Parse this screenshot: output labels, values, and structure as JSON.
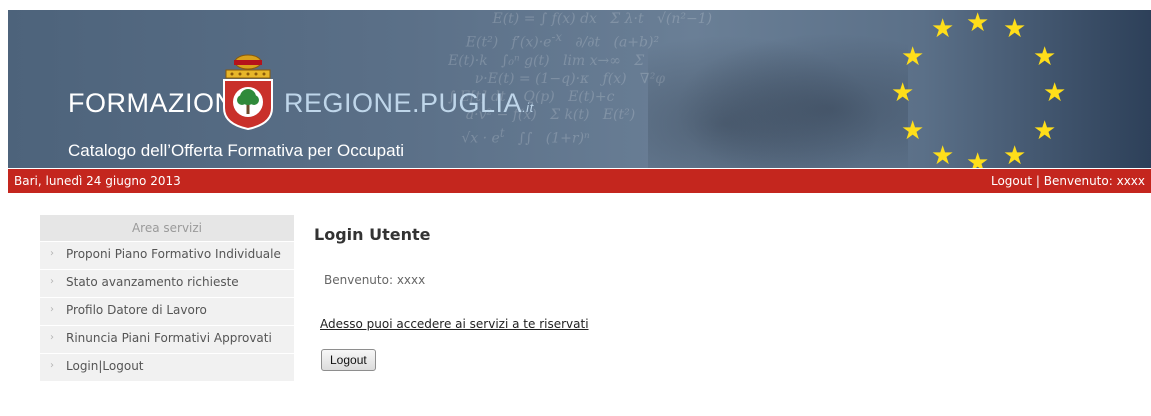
{
  "header": {
    "logo_left": "FORMAZIONE.",
    "logo_right": "REGIONE.PUGLIA",
    "logo_right_suffix": ".it",
    "subtitle": "Catalogo dell’Offerta Formativa per Occupati",
    "star_color": "#ffde1a"
  },
  "topbar": {
    "date": "Bari, lunedì 24 giugno 2013",
    "logout_link": "Logout",
    "separator": "|",
    "welcome": "Benvenuto: xxxx",
    "background": "#c4261e"
  },
  "sidebar": {
    "title": "Area servizi",
    "items": [
      {
        "label": "Proponi Piano Formativo Individuale"
      },
      {
        "label": "Stato avanzamento richieste"
      },
      {
        "label": "Profilo Datore di Lavoro"
      },
      {
        "label": "Rinuncia Piani Formativi Approvati"
      },
      {
        "label": "Login|Logout"
      }
    ]
  },
  "main": {
    "title": "Login Utente",
    "welcome": "Benvenuto: xxxx",
    "access_link": "Adesso puoi accedere ai servizi a te riservati",
    "logout_button": "Logout"
  }
}
